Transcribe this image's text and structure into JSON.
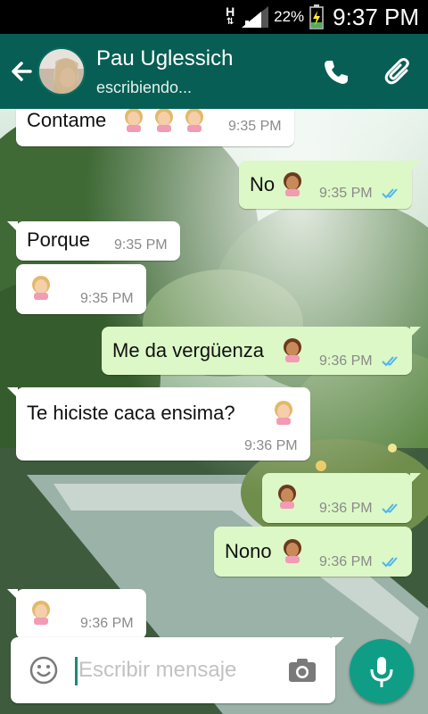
{
  "status_bar": {
    "network_indicator": "H",
    "battery_percent": "22%",
    "time": "9:37 PM"
  },
  "header": {
    "contact_name": "Pau Uglessich",
    "contact_status": "escribiendo...",
    "icons": [
      "back-arrow-icon",
      "avatar",
      "phone-icon",
      "paperclip-icon"
    ]
  },
  "colors": {
    "header_bg": "#075e54",
    "incoming_bubble": "#ffffff",
    "outgoing_bubble": "#dcf8c6",
    "read_ticks": "#4fb6ec",
    "mic_button": "#0f9d86"
  },
  "messages": [
    {
      "direction": "incoming",
      "text": "Contame",
      "emoji": [
        "woman-light-skin",
        "woman-light-skin",
        "woman-light-skin"
      ],
      "time": "9:35 PM"
    },
    {
      "direction": "outgoing",
      "text": "No",
      "emoji": [
        "woman-tipping-hand-medium"
      ],
      "time": "9:35 PM",
      "read": true
    },
    {
      "direction": "incoming",
      "text": "Porque",
      "emoji": [],
      "time": "9:35 PM"
    },
    {
      "direction": "incoming",
      "text": "",
      "emoji": [
        "woman-light-skin"
      ],
      "time": "9:35 PM"
    },
    {
      "direction": "outgoing",
      "text": "Me da vergüenza",
      "emoji": [
        "woman-tipping-hand-medium"
      ],
      "time": "9:36 PM",
      "read": true
    },
    {
      "direction": "incoming",
      "text": "Te hiciste caca ensima?",
      "emoji": [
        "woman-light-skin"
      ],
      "time": "9:36 PM"
    },
    {
      "direction": "outgoing",
      "text": "",
      "emoji": [
        "woman-tipping-hand-medium"
      ],
      "time": "9:36 PM",
      "read": true
    },
    {
      "direction": "outgoing",
      "text": "Nono",
      "emoji": [
        "woman-tipping-hand-medium"
      ],
      "time": "9:36 PM",
      "read": true
    },
    {
      "direction": "incoming",
      "text": "",
      "emoji": [
        "woman-light-skin"
      ],
      "time": "9:36 PM"
    }
  ],
  "compose": {
    "placeholder": "Escribir mensaje",
    "icons": [
      "smiley-icon",
      "camera-icon",
      "microphone-icon"
    ]
  }
}
